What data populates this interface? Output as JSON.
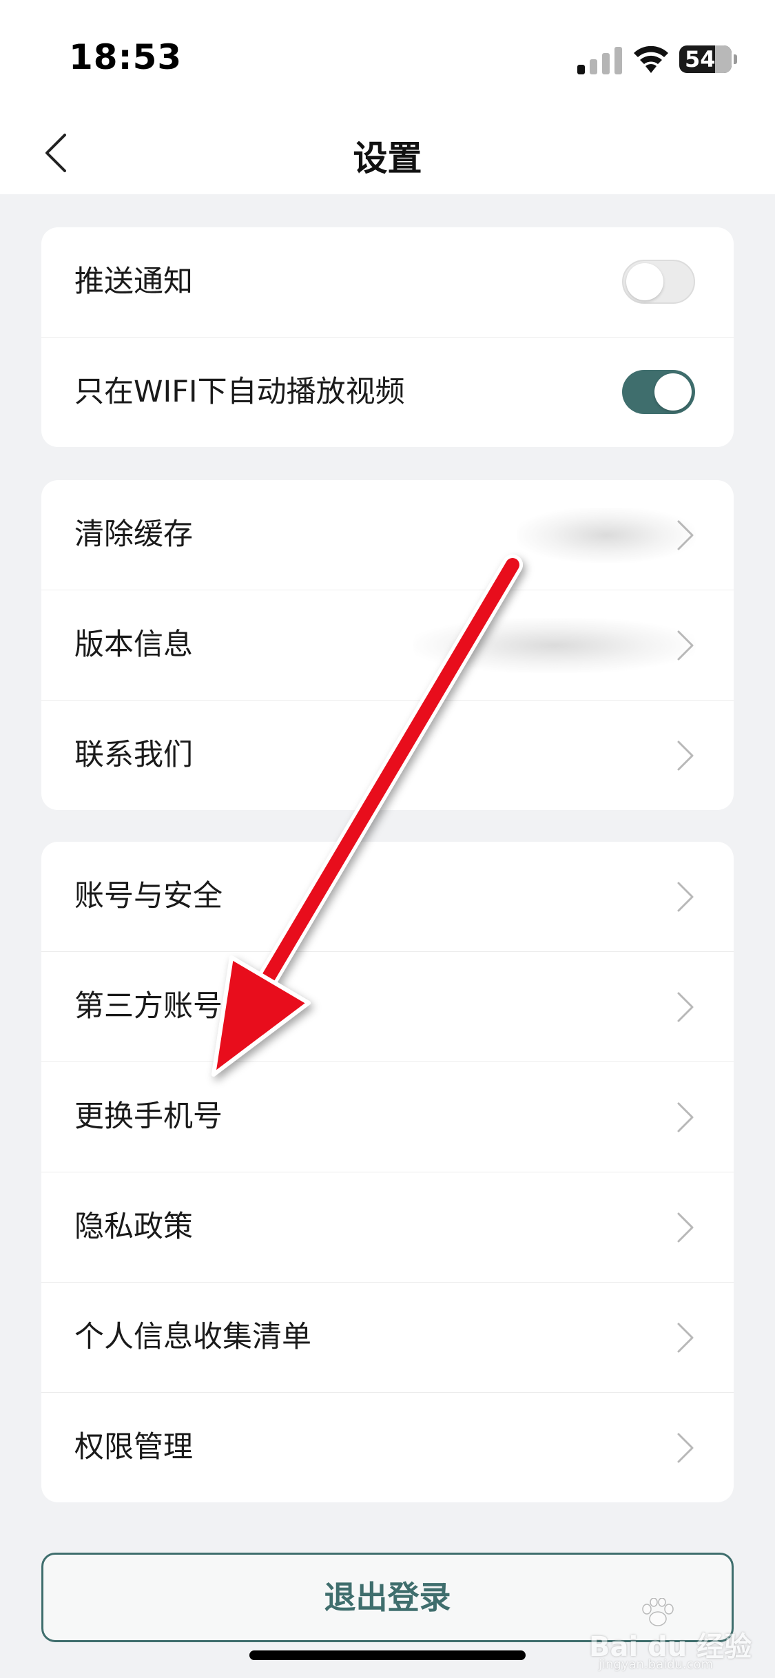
{
  "status_bar": {
    "time": "18:53",
    "battery_level": "54",
    "icons": [
      "signal-icon",
      "wifi-icon",
      "battery-icon"
    ]
  },
  "header": {
    "title": "设置",
    "back_icon": "chevron-left-icon"
  },
  "groups": [
    {
      "items": [
        {
          "label": "推送通知",
          "control": "toggle",
          "on": false
        },
        {
          "label": "只在WIFI下自动播放视频",
          "control": "toggle",
          "on": true
        }
      ]
    },
    {
      "items": [
        {
          "label": "清除缓存",
          "control": "chevron"
        },
        {
          "label": "版本信息",
          "control": "chevron"
        },
        {
          "label": "联系我们",
          "control": "chevron"
        }
      ]
    },
    {
      "items": [
        {
          "label": "账号与安全",
          "control": "chevron"
        },
        {
          "label": "第三方账号",
          "control": "chevron"
        },
        {
          "label": "更换手机号",
          "control": "chevron"
        },
        {
          "label": "隐私政策",
          "control": "chevron"
        },
        {
          "label": "个人信息收集清单",
          "control": "chevron"
        },
        {
          "label": "权限管理",
          "control": "chevron"
        }
      ]
    }
  ],
  "logout_label": "退出登录",
  "watermark": {
    "text": "Bai du 经验",
    "sub": "jingyan.baidu.com"
  },
  "colors": {
    "accent": "#3f6e6d",
    "annotation_arrow": "#e8101a",
    "background": "#f1f2f4"
  }
}
